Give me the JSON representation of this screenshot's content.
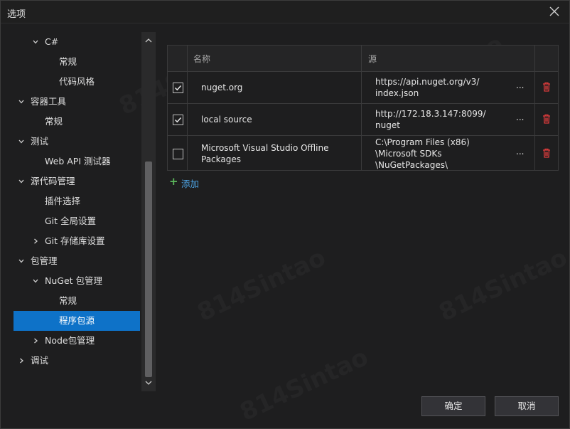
{
  "window": {
    "title": "选项"
  },
  "tree": [
    {
      "label": "C#",
      "chevron": "down",
      "level": 2
    },
    {
      "label": "常规",
      "chevron": "",
      "level": 3
    },
    {
      "label": "代码风格",
      "chevron": "",
      "level": 3
    },
    {
      "label": "容器工具",
      "chevron": "down",
      "level": 1
    },
    {
      "label": "常规",
      "chevron": "",
      "level": 2
    },
    {
      "label": "测试",
      "chevron": "down",
      "level": 1
    },
    {
      "label": "Web API 测试器",
      "chevron": "",
      "level": 2
    },
    {
      "label": "源代码管理",
      "chevron": "down",
      "level": 1
    },
    {
      "label": "插件选择",
      "chevron": "",
      "level": 2
    },
    {
      "label": "Git 全局设置",
      "chevron": "",
      "level": 2
    },
    {
      "label": "Git 存储库设置",
      "chevron": "right",
      "level": 2
    },
    {
      "label": "包管理",
      "chevron": "down",
      "level": 1
    },
    {
      "label": "NuGet 包管理",
      "chevron": "down",
      "level": 2
    },
    {
      "label": "常规",
      "chevron": "",
      "level": 3
    },
    {
      "label": "程序包源",
      "chevron": "",
      "level": 3,
      "selected": true
    },
    {
      "label": "Node包管理",
      "chevron": "right",
      "level": 2
    },
    {
      "label": "调试",
      "chevron": "right",
      "level": 1
    }
  ],
  "grid": {
    "headers": {
      "name": "名称",
      "source": "源"
    },
    "rows": [
      {
        "checked": true,
        "name": "nuget.org",
        "source": "https://api.nuget.org/v3/\nindex.json",
        "more": "...",
        "icon": "trash-icon"
      },
      {
        "checked": true,
        "name": "local source",
        "source": "http://172.18.3.147:8099/\nnuget",
        "more": "...",
        "icon": "trash-icon"
      },
      {
        "checked": false,
        "name": "Microsoft Visual Studio Offline\nPackages",
        "source": "C:\\Program Files (x86)\n\\Microsoft SDKs\n\\NuGetPackages\\",
        "more": "...",
        "icon": "trash-icon"
      }
    ]
  },
  "add": {
    "label": "添加",
    "icon": "plus-icon"
  },
  "buttons": {
    "ok": "确定",
    "cancel": "取消"
  },
  "colors": {
    "accent": "#0e72c8",
    "danger": "#e03c3c",
    "add_plus": "#5cb85c",
    "link": "#4da3e3"
  }
}
